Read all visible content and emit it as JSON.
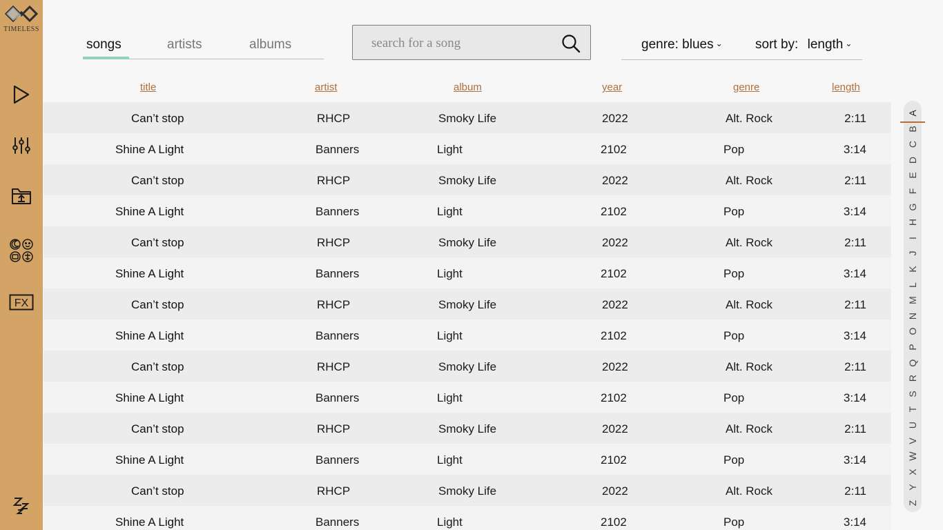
{
  "app": {
    "logo_text": "TIMELESS"
  },
  "sidebar": {
    "icons": [
      "play-icon",
      "equalizer-icon",
      "folder-upload-icon",
      "moods-icon",
      "fx-icon",
      "sleep-icon"
    ],
    "fx_label": "FX",
    "sleep_label": "Zz"
  },
  "tabs": [
    {
      "label": "songs",
      "active": true
    },
    {
      "label": "artists",
      "active": false
    },
    {
      "label": "albums",
      "active": false
    }
  ],
  "search": {
    "placeholder": "search for a song",
    "value": ""
  },
  "filters": {
    "genre_label": "genre: blues",
    "sort_label": "sort by:",
    "sort_value": "length"
  },
  "columns": {
    "title": "title",
    "artist": "artist",
    "album": "album",
    "year": "year",
    "genre": "genre",
    "length": "length"
  },
  "songs": [
    {
      "title": "Can’t stop",
      "artist": "RHCP",
      "album": "Smoky Life",
      "year": "2022",
      "genre": "Alt. Rock",
      "length": "2:11"
    },
    {
      "title": "Shine A Light",
      "artist": "Banners",
      "album": "Light",
      "year": "2102",
      "genre": "Pop",
      "length": "3:14"
    },
    {
      "title": "Can’t stop",
      "artist": "RHCP",
      "album": "Smoky Life",
      "year": "2022",
      "genre": "Alt. Rock",
      "length": "2:11"
    },
    {
      "title": "Shine A Light",
      "artist": "Banners",
      "album": "Light",
      "year": "2102",
      "genre": "Pop",
      "length": "3:14"
    },
    {
      "title": "Can’t stop",
      "artist": "RHCP",
      "album": "Smoky Life",
      "year": "2022",
      "genre": "Alt. Rock",
      "length": "2:11"
    },
    {
      "title": "Shine A Light",
      "artist": "Banners",
      "album": "Light",
      "year": "2102",
      "genre": "Pop",
      "length": "3:14"
    },
    {
      "title": "Can’t stop",
      "artist": "RHCP",
      "album": "Smoky Life",
      "year": "2022",
      "genre": "Alt. Rock",
      "length": "2:11"
    },
    {
      "title": "Shine A Light",
      "artist": "Banners",
      "album": "Light",
      "year": "2102",
      "genre": "Pop",
      "length": "3:14"
    },
    {
      "title": "Can’t stop",
      "artist": "RHCP",
      "album": "Smoky Life",
      "year": "2022",
      "genre": "Alt. Rock",
      "length": "2:11"
    },
    {
      "title": "Shine A Light",
      "artist": "Banners",
      "album": "Light",
      "year": "2102",
      "genre": "Pop",
      "length": "3:14"
    },
    {
      "title": "Can’t stop",
      "artist": "RHCP",
      "album": "Smoky Life",
      "year": "2022",
      "genre": "Alt. Rock",
      "length": "2:11"
    },
    {
      "title": "Shine A Light",
      "artist": "Banners",
      "album": "Light",
      "year": "2102",
      "genre": "Pop",
      "length": "3:14"
    },
    {
      "title": "Can’t stop",
      "artist": "RHCP",
      "album": "Smoky Life",
      "year": "2022",
      "genre": "Alt. Rock",
      "length": "2:11"
    },
    {
      "title": "Shine A Light",
      "artist": "Banners",
      "album": "Light",
      "year": "2102",
      "genre": "Pop",
      "length": "3:14"
    }
  ],
  "alphabet": [
    "A",
    "B",
    "C",
    "D",
    "E",
    "F",
    "G",
    "H",
    "I",
    "J",
    "K",
    "L",
    "M",
    "N",
    "O",
    "P",
    "Q",
    "R",
    "S",
    "T",
    "U",
    "V",
    "W",
    "X",
    "Y",
    "Z"
  ],
  "alphabet_active": "A",
  "colors": {
    "sidebar": "#d4a467",
    "accent": "#b06f3c",
    "tab_underline": "#8fd1bb"
  }
}
